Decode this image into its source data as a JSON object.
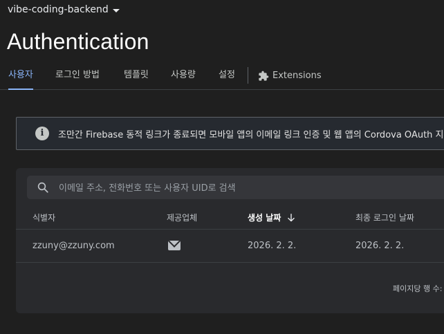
{
  "project": {
    "name": "vibe-coding-backend"
  },
  "page": {
    "title": "Authentication"
  },
  "tabs": [
    {
      "label": "사용자",
      "active": true
    },
    {
      "label": "로그인 방법"
    },
    {
      "label": "템플릿"
    },
    {
      "label": "사용량"
    },
    {
      "label": "설정"
    },
    {
      "label": "Extensions",
      "icon": "puzzle-icon"
    }
  ],
  "banner": {
    "icon": "info-icon",
    "text": "조만간 Firebase 동적 링크가 종료되면 모바일 앱의 이메일 링크 인증 및 웹 앱의 Cordova OAuth 지"
  },
  "search": {
    "placeholder": "이메일 주소, 전화번호 또는 사용자 UID로 검색"
  },
  "table": {
    "columns": [
      "식별자",
      "제공업체",
      "생성 날짜",
      "최종 로그인 날짜"
    ],
    "sorted_column": "생성 날짜",
    "sort_direction": "descending",
    "rows": [
      {
        "identifier": "zzuny@zzuny.com",
        "provider": "email-icon",
        "created": "2026. 2. 2.",
        "last_sign_in": "2026. 2. 2."
      }
    ],
    "pager_label": "페이지당 행 수:"
  },
  "colors": {
    "background": "#1f1f1f",
    "card": "#292a2d",
    "accent": "#8ab4f8"
  }
}
